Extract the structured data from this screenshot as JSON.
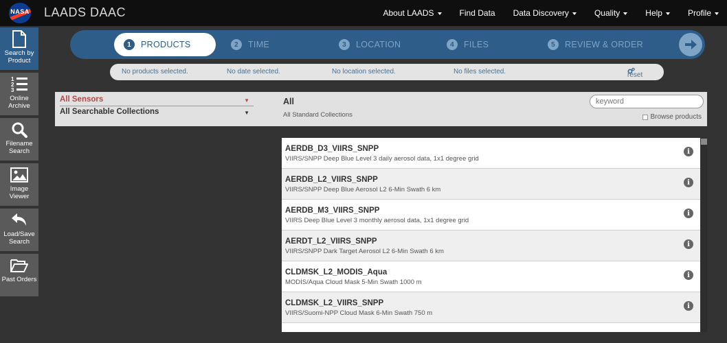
{
  "header": {
    "logo_text": "NASA",
    "app_title": "LAADS DAAC",
    "nav": [
      {
        "label": "About LAADS"
      },
      {
        "label": "Find Data"
      },
      {
        "label": "Data Discovery"
      },
      {
        "label": "Quality"
      },
      {
        "label": "Help"
      },
      {
        "label": "Profile"
      }
    ]
  },
  "sidebar": {
    "items": [
      {
        "label": "Search by Product",
        "icon": "document-icon"
      },
      {
        "label": "Online Archive",
        "icon": "numbered-list-icon"
      },
      {
        "label": "Filename Search",
        "icon": "magnifier-icon"
      },
      {
        "label": "Image Viewer",
        "icon": "image-icon"
      },
      {
        "label": "Load/Save Search",
        "icon": "undo-arrow-icon"
      },
      {
        "label": "Past Orders",
        "icon": "folder-open-icon"
      }
    ]
  },
  "steps": [
    {
      "num": "1",
      "label": "PRODUCTS"
    },
    {
      "num": "2",
      "label": "TIME"
    },
    {
      "num": "3",
      "label": "LOCATION"
    },
    {
      "num": "4",
      "label": "FILES"
    },
    {
      "num": "5",
      "label": "REVIEW & ORDER"
    }
  ],
  "summary": {
    "products": "No products selected.",
    "date": "No date selected.",
    "location": "No location selected.",
    "files": "No files selected.",
    "reset": "reset"
  },
  "filters": {
    "sensor": "All Sensors",
    "collection": "All Searchable Collections",
    "category_title": "All",
    "category_subtitle": "All Standard Collections",
    "keyword_placeholder": "keyword",
    "browse_label": "Browse products"
  },
  "products": [
    {
      "name": "AERDB_D3_VIIRS_SNPP",
      "desc": "VIIRS/SNPP Deep Blue Level 3 daily aerosol data, 1x1 degree grid"
    },
    {
      "name": "AERDB_L2_VIIRS_SNPP",
      "desc": "VIIRS/SNPP Deep Blue Aerosol L2 6-Min Swath 6 km"
    },
    {
      "name": "AERDB_M3_VIIRS_SNPP",
      "desc": "VIIRS Deep Blue Level 3 monthly aerosol data, 1x1 degree grid"
    },
    {
      "name": "AERDT_L2_VIIRS_SNPP",
      "desc": "VIIRS/SNPP Dark Target Aerosol L2 6-Min Swath 6 km"
    },
    {
      "name": "CLDMSK_L2_MODIS_Aqua",
      "desc": "MODIS/Aqua Cloud Mask 5-Min Swath 1000 m"
    },
    {
      "name": "CLDMSK_L2_VIIRS_SNPP",
      "desc": "VIIRS/Suomi-NPP Cloud Mask 6-Min Swath 750 m"
    }
  ],
  "colors": {
    "accent": "#2d5d88",
    "step_inactive": "#7ea4c6",
    "sensor_red": "#b04a4a"
  }
}
